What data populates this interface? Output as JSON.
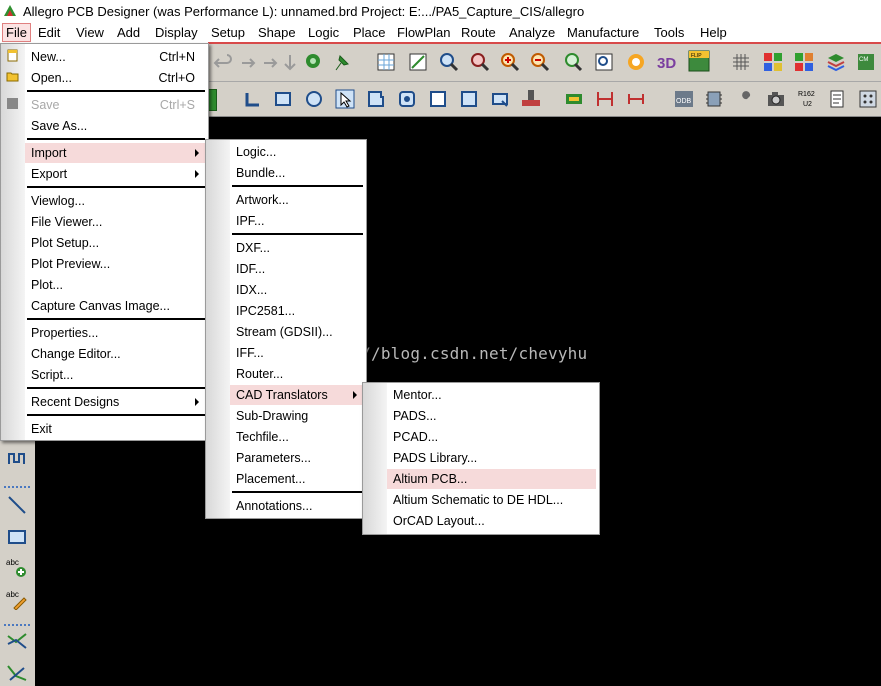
{
  "window": {
    "title": "Allegro PCB Designer (was Performance L): unnamed.brd  Project: E:.../PA5_Capture_CIS/allegro"
  },
  "menubar": {
    "items": [
      "File",
      "Edit",
      "View",
      "Add",
      "Display",
      "Setup",
      "Shape",
      "Logic",
      "Place",
      "FlowPlan",
      "Route",
      "Analyze",
      "Manufacture",
      "Tools",
      "Help"
    ]
  },
  "file_menu": {
    "items": [
      {
        "label": "New...",
        "shortcut": "Ctrl+N"
      },
      {
        "label": "Open...",
        "shortcut": "Ctrl+O"
      },
      {
        "label": "Save",
        "shortcut": "Ctrl+S"
      },
      {
        "label": "Save As..."
      },
      {
        "label": "Import"
      },
      {
        "label": "Export"
      },
      {
        "label": "Viewlog..."
      },
      {
        "label": "File Viewer..."
      },
      {
        "label": "Plot Setup..."
      },
      {
        "label": "Plot Preview..."
      },
      {
        "label": "Plot..."
      },
      {
        "label": "Capture Canvas Image..."
      },
      {
        "label": "Properties..."
      },
      {
        "label": "Change Editor..."
      },
      {
        "label": "Script..."
      },
      {
        "label": "Recent Designs"
      },
      {
        "label": "Exit"
      }
    ]
  },
  "import_menu": {
    "items": [
      {
        "label": "Logic..."
      },
      {
        "label": "Bundle..."
      },
      {
        "label": "Artwork..."
      },
      {
        "label": "IPF..."
      },
      {
        "label": "DXF..."
      },
      {
        "label": "IDF..."
      },
      {
        "label": "IDX..."
      },
      {
        "label": "IPC2581..."
      },
      {
        "label": "Stream (GDSII)..."
      },
      {
        "label": "IFF..."
      },
      {
        "label": "Router..."
      },
      {
        "label": "CAD Translators"
      },
      {
        "label": "Sub-Drawing"
      },
      {
        "label": "Techfile..."
      },
      {
        "label": "Parameters..."
      },
      {
        "label": "Placement..."
      },
      {
        "label": "Annotations..."
      }
    ]
  },
  "cad_menu": {
    "items": [
      {
        "label": "Mentor..."
      },
      {
        "label": "PADS..."
      },
      {
        "label": "PCAD..."
      },
      {
        "label": "PADS Library..."
      },
      {
        "label": "Altium PCB..."
      },
      {
        "label": "Altium Schematic to DE HDL..."
      },
      {
        "label": "OrCAD Layout..."
      }
    ]
  },
  "watermark": "http://blog.csdn.net/chevyhu",
  "icons": {
    "toolbar1": [
      "undo-icon",
      "redo-icon",
      "redo-icon",
      "down-arrow-icon",
      "pin-icon",
      "pin-icon",
      "grid-icon",
      "zoom-fit-icon",
      "zoom-icon",
      "zoom-in-icon",
      "zoom-out-icon",
      "zoom-prev-icon",
      "zoom-window-icon",
      "redraw-icon",
      "3d-view-icon",
      "flip-icon",
      "grid-toggle-icon",
      "color-icon",
      "layers-icon",
      "stack-icon",
      "cmd-icon"
    ],
    "toolbar2": [
      "move-icon",
      "rectangle-icon",
      "circle-icon",
      "select-icon",
      "shape-icon",
      "shape2-icon",
      "square-icon",
      "fill-icon",
      "void-icon",
      "board-icon",
      "dimension-icon",
      "dimension2-icon",
      "odb-icon",
      "component-icon",
      "wrench-icon",
      "camera-icon",
      "refdes-icon",
      "sheet-icon",
      "chip-icon"
    ],
    "leftbar": [
      "wave-icon",
      "line-icon",
      "rectangle-icon",
      "add-text-icon",
      "edit-text-icon",
      "connect-icon",
      "route-icon"
    ]
  },
  "colors": {
    "canvas": "#000000",
    "highlight": "#f6dada",
    "toolbar": "#d4d0c8",
    "accent_red": "#d84a4a"
  }
}
